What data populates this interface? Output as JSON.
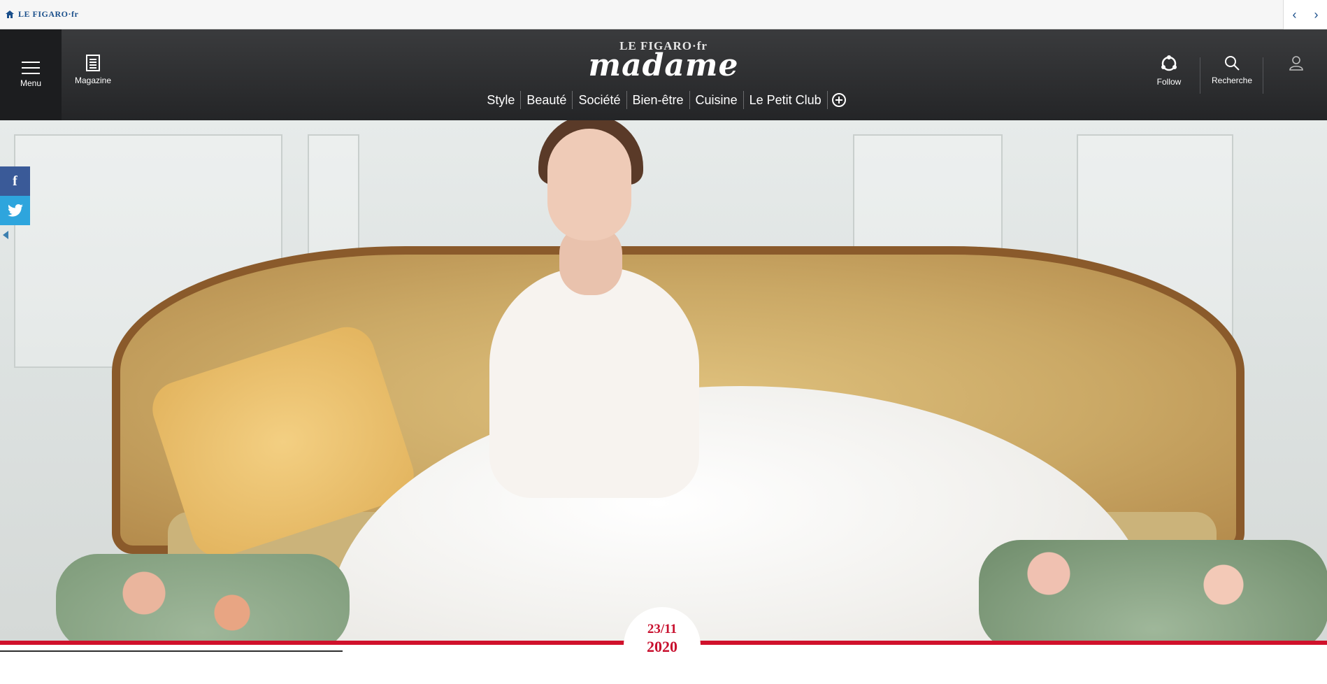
{
  "topbar": {
    "logo_text": "LE FIGARO·fr",
    "prev_icon": "chevron-left-icon",
    "next_icon": "chevron-right-icon",
    "prev_glyph": "‹",
    "next_glyph": "›"
  },
  "header": {
    "menu_label": "Menu",
    "magazine_label": "Magazine",
    "brand_top": "LE FIGARO·fr",
    "brand_main": "madame",
    "follow_label": "Follow",
    "search_label": "Recherche"
  },
  "nav": {
    "items": [
      "Style",
      "Beauté",
      "Société",
      "Bien-être",
      "Cuisine",
      "Le Petit Club"
    ]
  },
  "social": {
    "facebook_glyph": "f",
    "twitter_glyph": "🐦"
  },
  "date_badge": {
    "day_month": "23/11",
    "year": "2020"
  },
  "colors": {
    "header_bg": "#2e2f31",
    "accent_red": "#d0112b",
    "facebook": "#3a5a98",
    "twitter": "#2ea5dd",
    "figaro_blue": "#1a4f8b"
  }
}
